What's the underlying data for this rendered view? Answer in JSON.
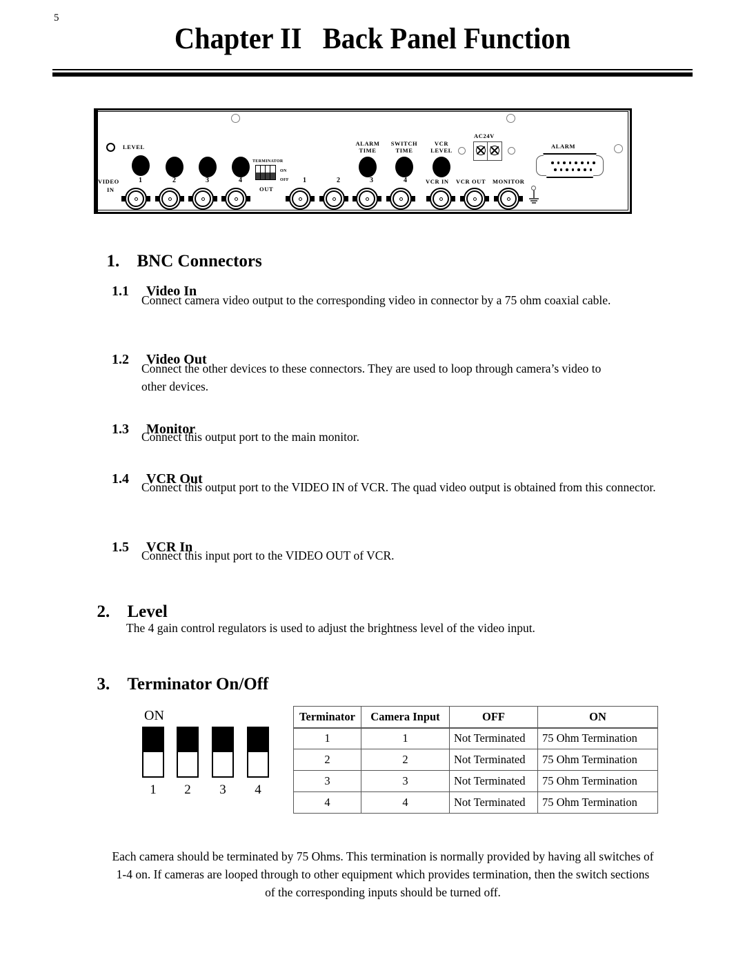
{
  "page": {
    "number": "5",
    "title": "Chapter II   Back Panel Function"
  },
  "figure": {
    "name": "back-panel-diagram",
    "labels": {
      "level": "LEVEL",
      "video": "VIDEO",
      "in": "IN",
      "out": "OUT",
      "terminator": "TERMINATOR",
      "term_on": "ON",
      "term_off": "OFF",
      "alarm_time": "ALARM\nTIME",
      "switch_time": "SWITCH\nTIME",
      "vcr_level": "VCR\nLEVEL",
      "ac24v": "AC24V",
      "alarm": "ALARM",
      "vcr_in": "VCR IN",
      "vcr_out": "VCR OUT",
      "monitor": "MONITOR"
    },
    "video_in_numbers": [
      "1",
      "2",
      "3",
      "4"
    ],
    "video_out_numbers": [
      "1",
      "2",
      "3",
      "4"
    ]
  },
  "sections": [
    {
      "number": "1.",
      "title": "BNC Connectors",
      "subsections": [
        {
          "number": "1.1",
          "title": "Video In",
          "body": "Connect camera video output to the corresponding video in connector by a 75 ohm coaxial cable."
        },
        {
          "number": "1.2",
          "title": "Video Out",
          "body": "Connect the other devices to these connectors. They are used to loop through camera’s video to other devices."
        },
        {
          "number": "1.3",
          "title": "Monitor",
          "body": "Connect this output port to the main monitor."
        },
        {
          "number": "1.4",
          "title": "VCR Out",
          "body": "Connect this output port to the VIDEO IN of VCR.  The quad video output is obtained from this connector."
        },
        {
          "number": "1.5",
          "title": "VCR In",
          "body": "Connect this input port to the VIDEO OUT of VCR."
        }
      ]
    },
    {
      "number": "2.",
      "title": "Level",
      "body": "The 4 gain control regulators is used to adjust the brightness level of the video input."
    },
    {
      "number": "3.",
      "title": "Terminator On/Off",
      "body": "Each camera should be terminated by 75 Ohms.  This termination is normally provided by having all switches of 1-4 on.  If cameras are looped through to other equipment which provides termination, then the switch sections of the corresponding inputs should be turned off."
    }
  ],
  "dip_diagram": {
    "on_label": "ON",
    "switch_numbers": [
      "1",
      "2",
      "3",
      "4"
    ],
    "positions": [
      "on",
      "on",
      "on",
      "on"
    ]
  },
  "table": {
    "headers": [
      "Terminator",
      "Camera Input",
      "OFF",
      "ON"
    ],
    "rows": [
      [
        "1",
        "1",
        "Not Terminated",
        "75 Ohm Termination"
      ],
      [
        "2",
        "2",
        "Not Terminated",
        "75 Ohm Termination"
      ],
      [
        "3",
        "3",
        "Not Terminated",
        "75 Ohm Termination"
      ],
      [
        "4",
        "4",
        "Not Terminated",
        "75 Ohm Termination"
      ]
    ]
  }
}
